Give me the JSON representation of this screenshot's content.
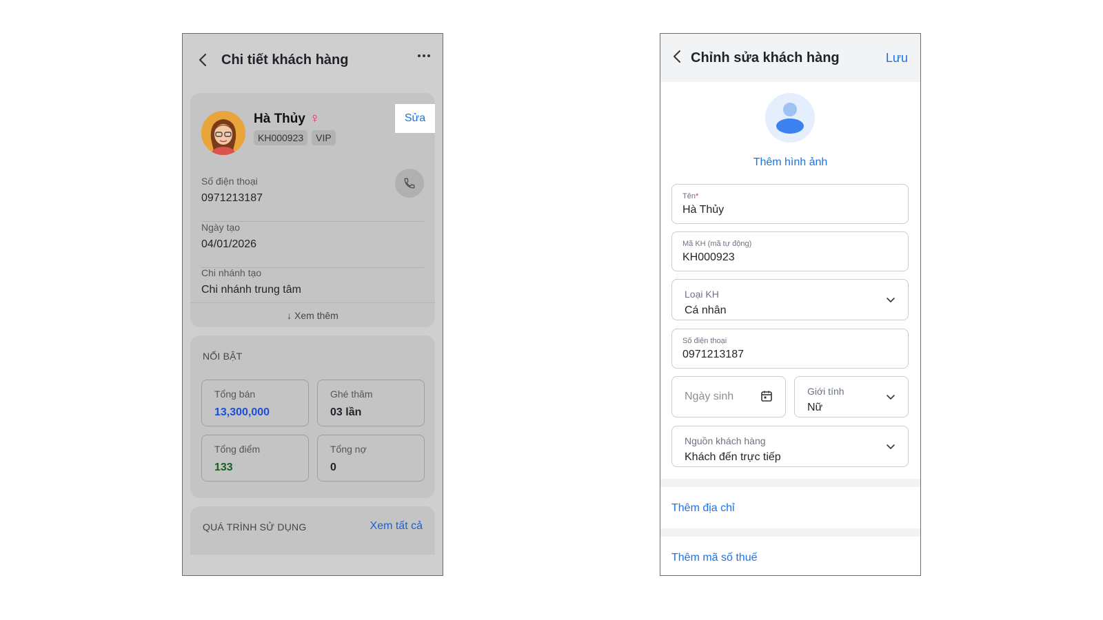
{
  "detail_screen": {
    "header": {
      "title": "Chi tiết khách hàng"
    },
    "customer": {
      "name": "Hà Thủy",
      "gender_symbol": "♀",
      "code": "KH000923",
      "tier": "VIP",
      "edit_label": "Sửa"
    },
    "info": [
      {
        "label": "Số điện thoại",
        "value": "0971213187"
      },
      {
        "label": "Ngày tạo",
        "value": "04/01/2026"
      },
      {
        "label": "Chi nhánh tạo",
        "value": "Chi nhánh trung tâm"
      }
    ],
    "see_more": "↓ Xem thêm",
    "highlights": {
      "title": "NỔI BẬT",
      "stats": [
        {
          "label": "Tổng bán",
          "value": "13,300,000",
          "color": "#1a4fd6"
        },
        {
          "label": "Ghé thăm",
          "value": "03 lần",
          "color": "#1f2328"
        },
        {
          "label": "Tổng điểm",
          "value": "133",
          "color": "#1b5e20"
        },
        {
          "label": "Tổng nợ",
          "value": "0",
          "color": "#1f2328"
        }
      ]
    },
    "usage": {
      "title": "QUÁ TRÌNH SỬ DỤNG",
      "see_all": "Xem tất cả"
    }
  },
  "edit_screen": {
    "header": {
      "title": "Chỉnh sửa khách hàng",
      "save_label": "Lưu"
    },
    "add_photo": "Thêm hình ảnh",
    "fields": {
      "name": {
        "label": "Tên",
        "required_mark": "*",
        "value": "Hà Thủy"
      },
      "code": {
        "label": "Mã KH (mã tự động)",
        "value": "KH000923"
      },
      "type": {
        "label": "Loại KH",
        "value": "Cá nhân"
      },
      "phone": {
        "label": "Số điện thoại",
        "value": "0971213187"
      },
      "birthday": {
        "placeholder": "Ngày sinh"
      },
      "gender": {
        "label": "Giới tính",
        "value": "Nữ"
      },
      "source": {
        "label": "Nguồn khách hàng",
        "value": "Khách đến trực tiếp"
      }
    },
    "add_address": "Thêm địa chỉ",
    "add_tax": "Thêm mã số thuế"
  },
  "colors": {
    "accent": "#1a73e8",
    "female": "#d6336c",
    "overlay_bg": "#cfcfcf"
  }
}
